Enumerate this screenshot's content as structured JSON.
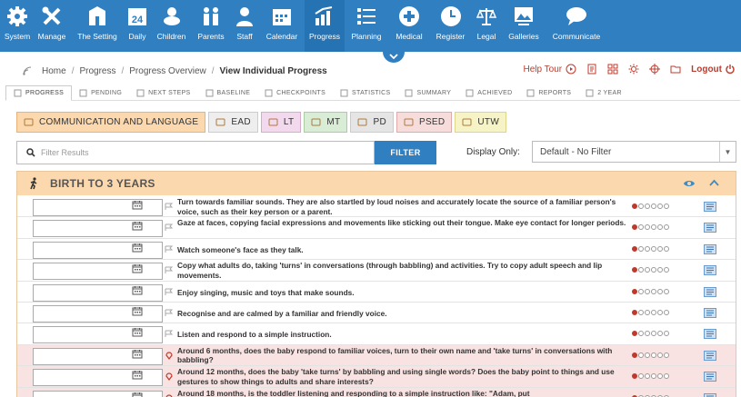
{
  "topnav": {
    "items": [
      {
        "label": "System",
        "icon": "gear-icon"
      },
      {
        "label": "Manage",
        "icon": "tools-icon"
      },
      {
        "label": "The Setting",
        "icon": "building-icon"
      },
      {
        "label": "Daily",
        "icon": "calendar-24-icon"
      },
      {
        "label": "Children",
        "icon": "baby-icon"
      },
      {
        "label": "Parents",
        "icon": "parents-icon"
      },
      {
        "label": "Staff",
        "icon": "staff-icon"
      },
      {
        "label": "Calendar",
        "icon": "calendar-icon"
      },
      {
        "label": "Progress",
        "icon": "progress-chart-icon"
      },
      {
        "label": "Planning",
        "icon": "planning-list-icon"
      },
      {
        "label": "Medical",
        "icon": "medical-cross-icon"
      },
      {
        "label": "Register",
        "icon": "register-clock-icon"
      },
      {
        "label": "Legal",
        "icon": "scales-icon"
      },
      {
        "label": "Galleries",
        "icon": "gallery-icon"
      },
      {
        "label": "Communicate",
        "icon": "speech-bubble-icon"
      }
    ],
    "active": "Progress",
    "color": "#2f7fc1"
  },
  "breadcrumb": {
    "items": [
      "Home",
      "Progress",
      "Progress Overview"
    ],
    "current": "View Individual Progress",
    "help_tour": "Help Tour",
    "logout": "Logout"
  },
  "subtabs": [
    {
      "label": "PROGRESS",
      "icon": "chart-icon",
      "active": true
    },
    {
      "label": "PENDING",
      "icon": "pending-icon"
    },
    {
      "label": "NEXT STEPS",
      "icon": "next-steps-icon"
    },
    {
      "label": "BASELINE",
      "icon": "baseline-icon"
    },
    {
      "label": "CHECKPOINTS",
      "icon": "checkpoint-icon"
    },
    {
      "label": "STATISTICS",
      "icon": "statistics-icon"
    },
    {
      "label": "SUMMARY",
      "icon": "summary-icon"
    },
    {
      "label": "ACHIEVED",
      "icon": "achieved-icon"
    },
    {
      "label": "REPORTS",
      "icon": "reports-icon"
    },
    {
      "label": "2 YEAR",
      "icon": "two-year-icon"
    }
  ],
  "areatabs": [
    {
      "label": "COMMUNICATION AND LANGUAGE",
      "bg": "#fbd8ad",
      "border": "#e8b27a",
      "active": true
    },
    {
      "label": "EAD",
      "bg": "#eeeeee",
      "border": "#cccccc"
    },
    {
      "label": "LT",
      "bg": "#f3d9ee",
      "border": "#d9aacb"
    },
    {
      "label": "MT",
      "bg": "#d9ecd5",
      "border": "#a9cca1"
    },
    {
      "label": "PD",
      "bg": "#e5e5e5",
      "border": "#cccccc"
    },
    {
      "label": "PSED",
      "bg": "#f7dcdc",
      "border": "#e0aaaa"
    },
    {
      "label": "UTW",
      "bg": "#f6f4c6",
      "border": "#dcd58a"
    }
  ],
  "filter": {
    "placeholder": "Filter Results",
    "button": "FILTER",
    "display_only_label": "Display Only:",
    "display_only_value": "Default - No Filter"
  },
  "section": {
    "title": "BIRTH TO 3 YEARS"
  },
  "rows": [
    {
      "text": "Turn towards familiar sounds. They are also startled by loud noises and accurately locate the source of a familiar person's voice, such as their key person or a parent.",
      "type": "statement",
      "level": 1
    },
    {
      "text": "Gaze at faces, copying facial expressions and movements like sticking out their tongue. Make eye contact for longer periods.",
      "type": "statement",
      "level": 1
    },
    {
      "text": "Watch someone's face as they talk.",
      "type": "statement",
      "level": 1
    },
    {
      "text": "Copy what adults do, taking 'turns' in conversations (through babbling) and activities. Try to copy adult speech and lip movements.",
      "type": "statement",
      "level": 1
    },
    {
      "text": "Enjoy singing, music and toys that make sounds.",
      "type": "statement",
      "level": 1
    },
    {
      "text": "Recognise and are calmed by a familiar and friendly voice.",
      "type": "statement",
      "level": 1
    },
    {
      "text": "Listen and respond to a simple instruction.",
      "type": "statement",
      "level": 1
    },
    {
      "text": "Around 6 months, does the baby respond to familiar voices, turn to their own name and 'take turns' in conversations with babbling?",
      "type": "checkpoint",
      "level": 1
    },
    {
      "text": "Around 12 months, does the baby 'take turns' by babbling and using single words? Does the baby point to things and use gestures to show things to adults and share interests?",
      "type": "checkpoint",
      "level": 1
    },
    {
      "text": "Around 18 months, is the toddler listening and responding to a simple instruction like: \"Adam, put",
      "type": "checkpoint",
      "level": 1
    }
  ]
}
